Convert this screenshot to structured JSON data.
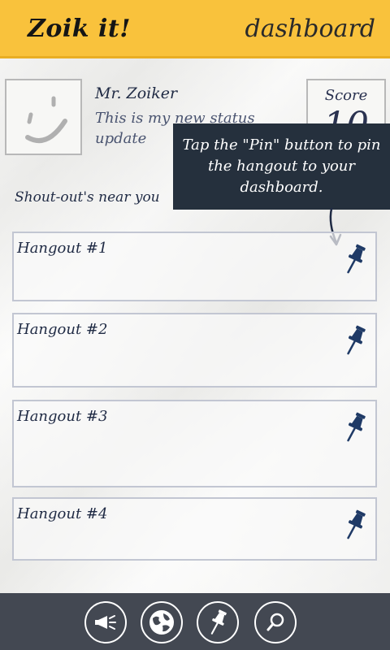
{
  "header": {
    "app_title": "Zoik it!",
    "page_label": "dashboard"
  },
  "profile": {
    "name": "Mr. Zoiker",
    "status": "This is my new status update",
    "score_label": "Score",
    "score_value": "10"
  },
  "section_label": "Shout-out's near you",
  "tooltip": {
    "text": "Tap the \"Pin\" button to pin the hangout to your dashboard."
  },
  "hangouts": [
    {
      "label": "Hangout #1"
    },
    {
      "label": "Hangout #2"
    },
    {
      "label": "Hangout #3"
    },
    {
      "label": "Hangout #4"
    }
  ],
  "bottom_nav": [
    {
      "icon": "megaphone-icon"
    },
    {
      "icon": "globe-icon"
    },
    {
      "icon": "pin-icon"
    },
    {
      "icon": "search-icon"
    }
  ],
  "colors": {
    "header": "#f9c23c",
    "ink": "#1f2a44",
    "tooltip_bg": "#25303d",
    "bottom_bar": "#434852",
    "pin": "#1f3a66"
  }
}
